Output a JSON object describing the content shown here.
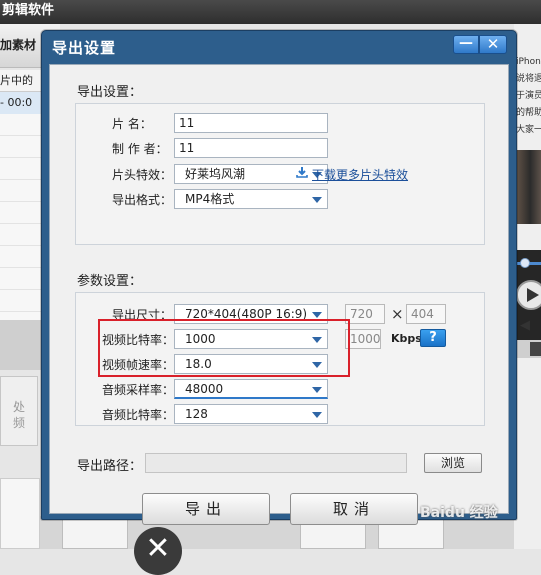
{
  "app": {
    "title": "剪辑软件",
    "add_material_tab": "加素材",
    "clip_header": "片中的",
    "clip_time": "- 00:0",
    "left_card_label": "处\n频"
  },
  "right_panel": {
    "lines": [
      "iPhone",
      "说将退",
      "于演员",
      "的帮助",
      "大家一"
    ]
  },
  "dialog": {
    "title": "导出设置",
    "minimize_symbol": "—",
    "close_symbol": "✕",
    "export_section_label": "导出设置：",
    "params_section_label": "参数设置：",
    "fields": {
      "name_label": "片    名：",
      "name_value": "11",
      "author_label": "制 作 者：",
      "author_value": "11",
      "intro_effect_label": "片头特效：",
      "intro_effect_value": "好莱坞风潮",
      "format_label": "导出格式：",
      "format_value": "MP4格式",
      "download_link": "下载更多片头特效",
      "size_label": "导出尺寸：",
      "size_value": "720*404(480P 16:9)",
      "width_value": "720",
      "height_value": "404",
      "times_sign": "×",
      "video_bitrate_label": "视频比特率：",
      "video_bitrate_value": "1000",
      "video_bitrate_custom": "1000",
      "kbps": "Kbps",
      "help": "?",
      "framerate_label": "视频帧速率：",
      "framerate_value": "18.0",
      "audio_sample_label": "音频采样率：",
      "audio_sample_value": "48000",
      "audio_bitrate_label": "音频比特率：",
      "audio_bitrate_value": "128"
    },
    "path_label": "导出路径：",
    "browse_button": "浏览",
    "export_button": "导出",
    "cancel_button": "取消"
  },
  "watermark": "Baidu 经验",
  "colors": {
    "dialog_frame": "#2d5e8c",
    "highlight": "#d9202a",
    "link": "#1b4f9a"
  }
}
